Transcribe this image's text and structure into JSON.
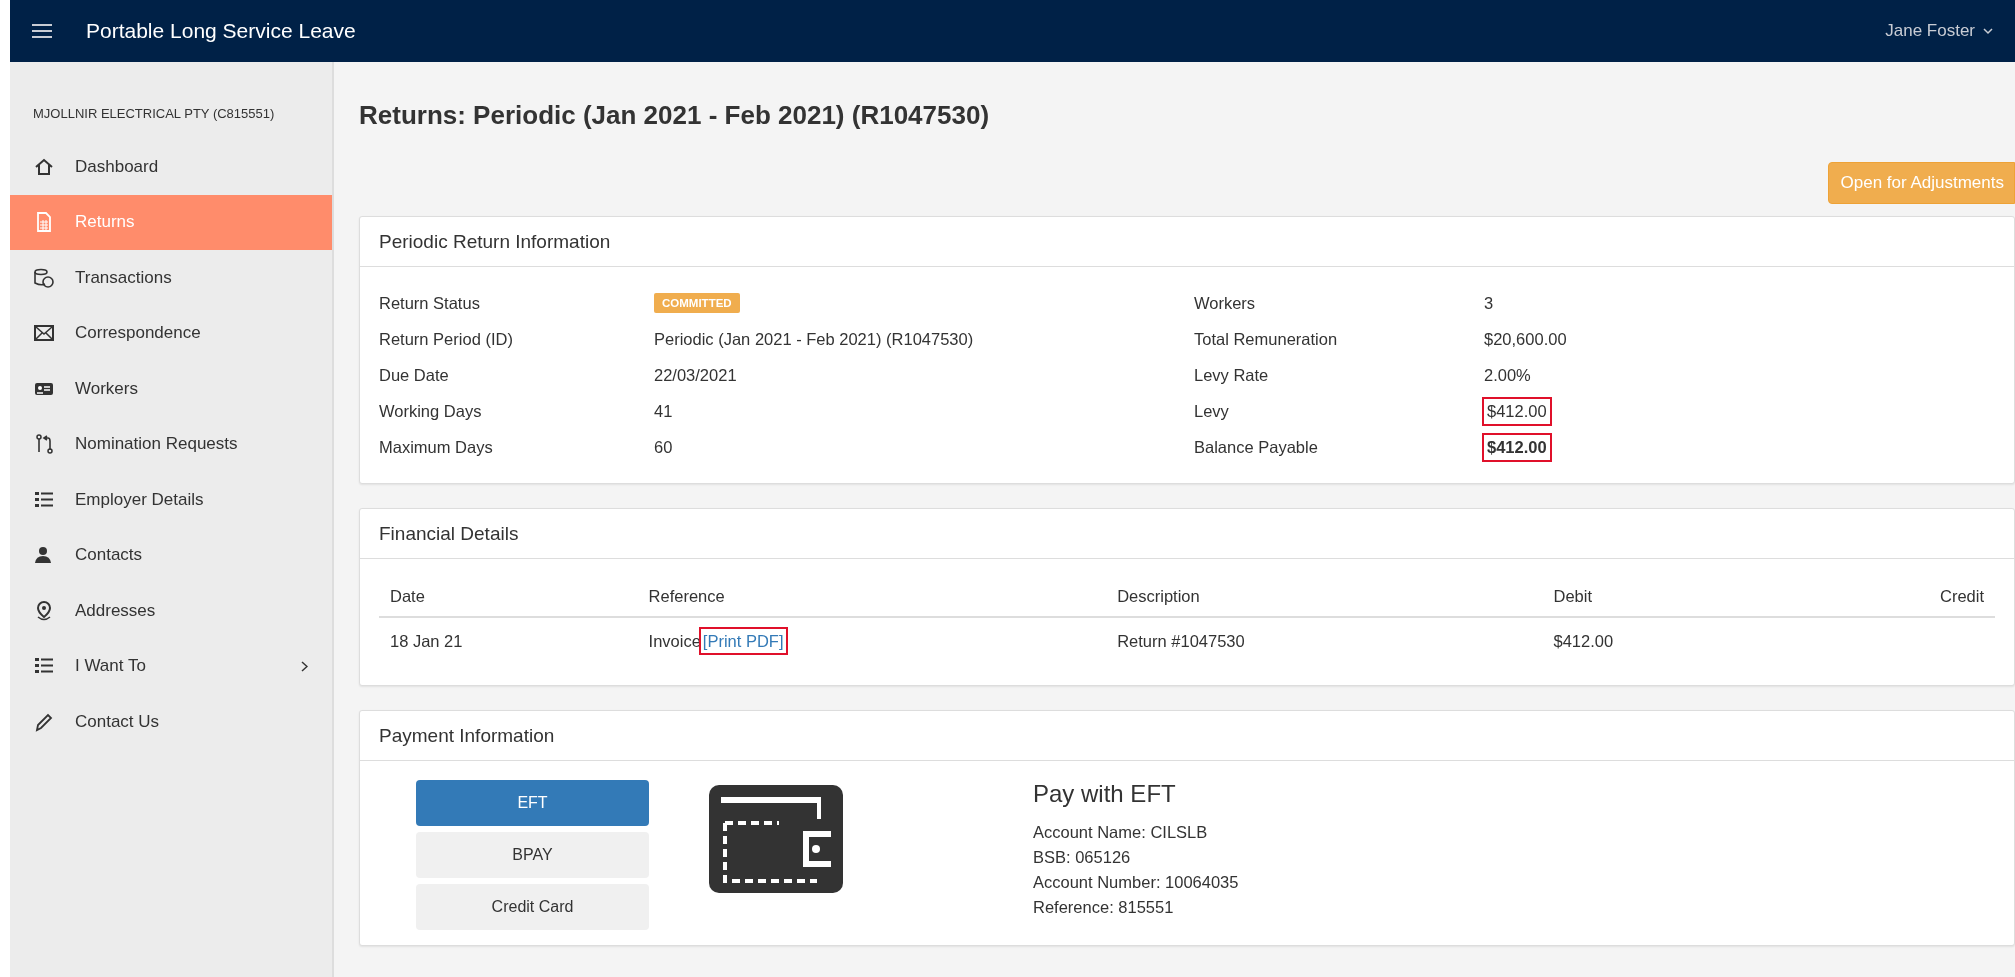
{
  "header": {
    "title": "Portable Long Service Leave",
    "user": "Jane Foster"
  },
  "sidebar": {
    "company": "MJOLLNIR ELECTRICAL PTY (C815551)",
    "items": [
      {
        "label": "Dashboard",
        "selected": false,
        "expandable": false
      },
      {
        "label": "Returns",
        "selected": true,
        "expandable": false
      },
      {
        "label": "Transactions",
        "selected": false,
        "expandable": false
      },
      {
        "label": "Correspondence",
        "selected": false,
        "expandable": false
      },
      {
        "label": "Workers",
        "selected": false,
        "expandable": false
      },
      {
        "label": "Nomination Requests",
        "selected": false,
        "expandable": false
      },
      {
        "label": "Employer Details",
        "selected": false,
        "expandable": false
      },
      {
        "label": "Contacts",
        "selected": false,
        "expandable": false
      },
      {
        "label": "Addresses",
        "selected": false,
        "expandable": false
      },
      {
        "label": "I Want To",
        "selected": false,
        "expandable": true
      },
      {
        "label": "Contact Us",
        "selected": false,
        "expandable": false
      }
    ]
  },
  "page_title": "Returns: Periodic (Jan 2021 - Feb 2021) (R1047530)",
  "action_button": "Open for Adjustments",
  "return_info": {
    "title": "Periodic Return Information",
    "left": [
      {
        "label": "Return Status",
        "value": "COMMITTED",
        "kind": "badge"
      },
      {
        "label": "Return Period (ID)",
        "value": "Periodic (Jan 2021 - Feb 2021) (R1047530)",
        "kind": "text"
      },
      {
        "label": "Due Date",
        "value": "22/03/2021",
        "kind": "text"
      },
      {
        "label": "Working Days",
        "value": "41",
        "kind": "text"
      },
      {
        "label": "Maximum Days",
        "value": "60",
        "kind": "text"
      }
    ],
    "right": [
      {
        "label": "Workers",
        "value": "3",
        "highlighted": false,
        "bold": false
      },
      {
        "label": "Total Remuneration",
        "value": "$20,600.00",
        "highlighted": false,
        "bold": false
      },
      {
        "label": "Levy Rate",
        "value": "2.00%",
        "highlighted": false,
        "bold": false
      },
      {
        "label": "Levy",
        "value": "$412.00",
        "highlighted": true,
        "bold": false
      },
      {
        "label": "Balance Payable",
        "value": "$412.00",
        "highlighted": true,
        "bold": true
      }
    ]
  },
  "financial": {
    "title": "Financial Details",
    "columns": [
      "Date",
      "Reference",
      "Description",
      "Debit",
      "Credit"
    ],
    "rows": [
      {
        "date": "18 Jan 21",
        "reference": "Invoice",
        "link": "[Print PDF]",
        "link_highlighted": true,
        "description": "Return #1047530",
        "debit": "$412.00"
      }
    ]
  },
  "payment": {
    "title": "Payment Information",
    "methods": [
      {
        "label": "EFT",
        "selected": true
      },
      {
        "label": "BPAY",
        "selected": false
      },
      {
        "label": "Credit Card",
        "selected": false
      }
    ],
    "heading": "Pay with EFT",
    "details": [
      "Account Name: CILSLB",
      "BSB: 065126",
      "Account Number: 10064035",
      "Reference: 815551"
    ]
  }
}
